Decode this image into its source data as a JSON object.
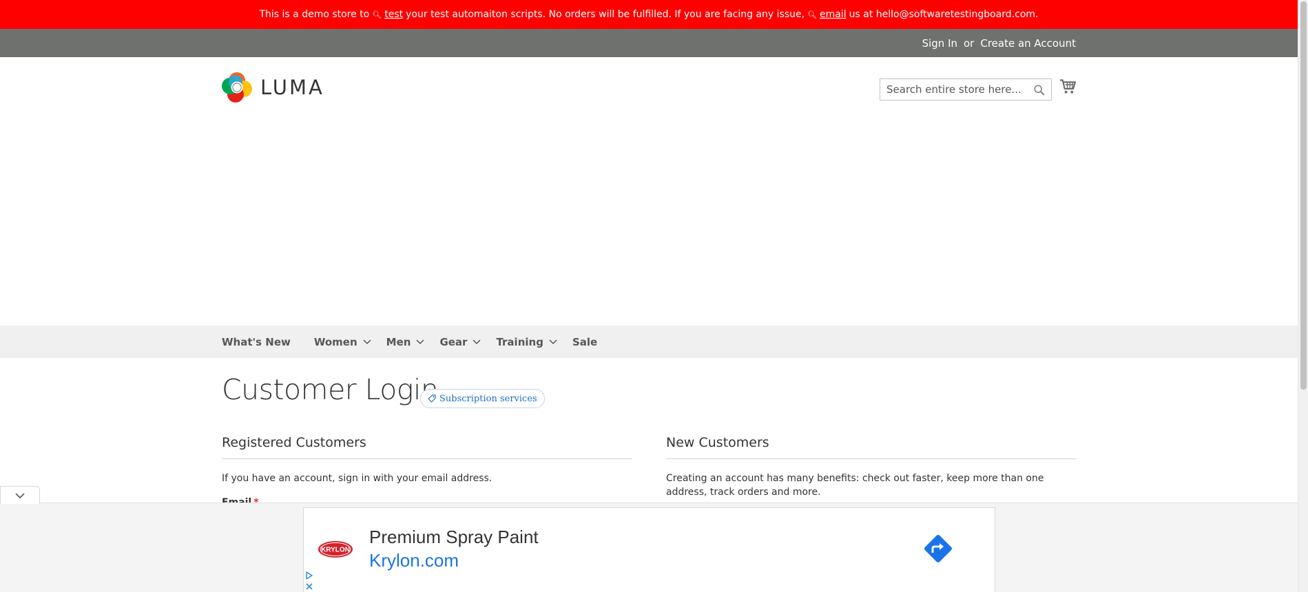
{
  "banner": {
    "text_1": "This is a demo store to",
    "keyword_1": "test",
    "text_2": "your test automaiton scripts. No orders will be fulfilled. If you are facing any issue,",
    "keyword_2": "email",
    "text_3": "us at hello@softwaretestingboard.com.",
    "background": "#ff0000"
  },
  "panel": {
    "sign_in": "Sign In",
    "or": "or",
    "create_account": "Create an Account",
    "background": "#6e716e"
  },
  "header": {
    "logo_text": "LUMA",
    "search_placeholder": "Search entire store here...",
    "search_icon": "search-icon",
    "cart_icon": "cart-icon"
  },
  "nav": {
    "items": [
      {
        "label": "What's New",
        "has_submenu": false
      },
      {
        "label": "Women",
        "has_submenu": true
      },
      {
        "label": "Men",
        "has_submenu": true
      },
      {
        "label": "Gear",
        "has_submenu": true
      },
      {
        "label": "Training",
        "has_submenu": true
      },
      {
        "label": "Sale",
        "has_submenu": false
      }
    ]
  },
  "main": {
    "title": "Customer Login",
    "subscription_badge": "Subscription services",
    "registered": {
      "heading": "Registered Customers",
      "text": "If you have an account, sign in with your email address.",
      "email_label": "Email",
      "required_mark": "*"
    },
    "new_customers": {
      "heading": "New Customers",
      "text": "Creating an account has many benefits: check out faster, keep more than one address, track orders and more."
    }
  },
  "ad": {
    "brand": "KRYLON",
    "title": "Premium Spray Paint",
    "domain": "Krylon.com",
    "arrow_icon": "directions-arrow-icon",
    "accent": "#1a73e8"
  }
}
